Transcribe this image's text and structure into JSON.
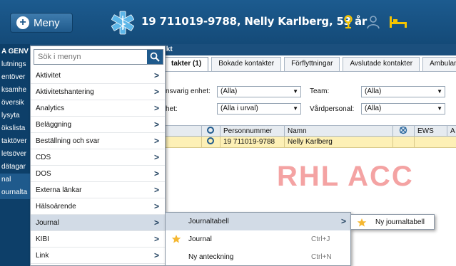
{
  "header": {
    "menu_label": "Meny",
    "patient_info": "19 711019-9788, Nelly Karlberg, 53 år",
    "icons": [
      "plus-icon",
      "star-of-life-icon",
      "location-pin-icon",
      "person-icon",
      "bed-icon"
    ],
    "accent": "#f5c400"
  },
  "sidebar": {
    "items": [
      "A GENV",
      "lutnings",
      "entöver",
      "ksamhe",
      "översik",
      "lysyta",
      "ökslista",
      "taktöver",
      "letsöver",
      "dätagar",
      "nal",
      "ournalta"
    ]
  },
  "subheader": {
    "title": "ikt"
  },
  "tabs": [
    "takter (1)",
    "Bokade kontakter",
    "Förflyttningar",
    "Avslutade kontakter",
    "Ambulans"
  ],
  "filters": {
    "label1": "nsvarig enhet:",
    "value1": "(Alla)",
    "label2": "Team:",
    "value2": "(Alla)",
    "label3": "het:",
    "value3": "(Alla i urval)",
    "label4": "Vårdpersonal:",
    "value4": "(Alla)"
  },
  "grid": {
    "columns": [
      "Personnummer",
      "Namn",
      "EWS",
      "A"
    ],
    "row": {
      "personnummer": "19 711019-9788",
      "namn": "Nelly Karlberg"
    }
  },
  "watermark": "RHL ACC",
  "menu": {
    "search_placeholder": "Sök i menyn",
    "items": [
      "Aktivitet",
      "Aktivitetshantering",
      "Analytics",
      "Beläggning",
      "Beställning och svar",
      "CDS",
      "DOS",
      "Externa länkar",
      "Hälsoärende",
      "Journal",
      "KIBI",
      "Link"
    ]
  },
  "submenu": {
    "items": [
      {
        "label": "Journaltabell",
        "shortcut": ""
      },
      {
        "label": "Journal",
        "shortcut": "Ctrl+J"
      },
      {
        "label": "Ny anteckning",
        "shortcut": "Ctrl+N"
      }
    ]
  },
  "submenu2": {
    "label": "Ny journaltabell"
  }
}
